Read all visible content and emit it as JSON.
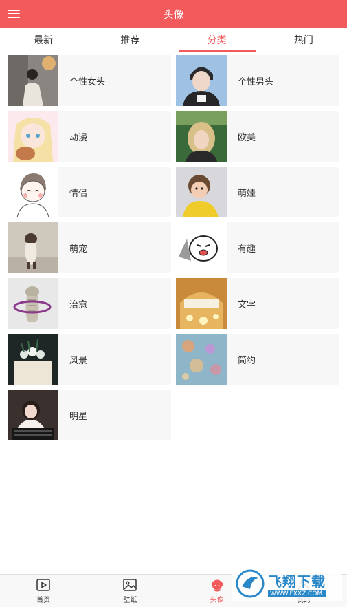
{
  "header": {
    "title": "头像",
    "menu_icon": "menu-icon"
  },
  "tabs": [
    {
      "label": "最新",
      "active": false
    },
    {
      "label": "推荐",
      "active": false
    },
    {
      "label": "分类",
      "active": true
    },
    {
      "label": "热门",
      "active": false
    }
  ],
  "categories": [
    {
      "label": "个性女头"
    },
    {
      "label": "个性男头"
    },
    {
      "label": "动漫"
    },
    {
      "label": "欧美"
    },
    {
      "label": "情侣"
    },
    {
      "label": "萌娃"
    },
    {
      "label": "萌宠"
    },
    {
      "label": "有趣"
    },
    {
      "label": "治愈"
    },
    {
      "label": "文字"
    },
    {
      "label": "风景"
    },
    {
      "label": "简约"
    },
    {
      "label": "明星"
    }
  ],
  "bottom_nav": [
    {
      "label": "首页",
      "icon": "play-icon",
      "active": false
    },
    {
      "label": "壁纸",
      "icon": "image-icon",
      "active": false
    },
    {
      "label": "头像",
      "icon": "avatar-icon",
      "active": true
    },
    {
      "label": "我的",
      "icon": "user-icon",
      "active": false
    }
  ],
  "watermark": {
    "brand": "飞翔下载",
    "url": "WWW.FXXZ.COM"
  },
  "colors": {
    "accent": "#f25a5b",
    "card_bg": "#f7f7f7"
  }
}
